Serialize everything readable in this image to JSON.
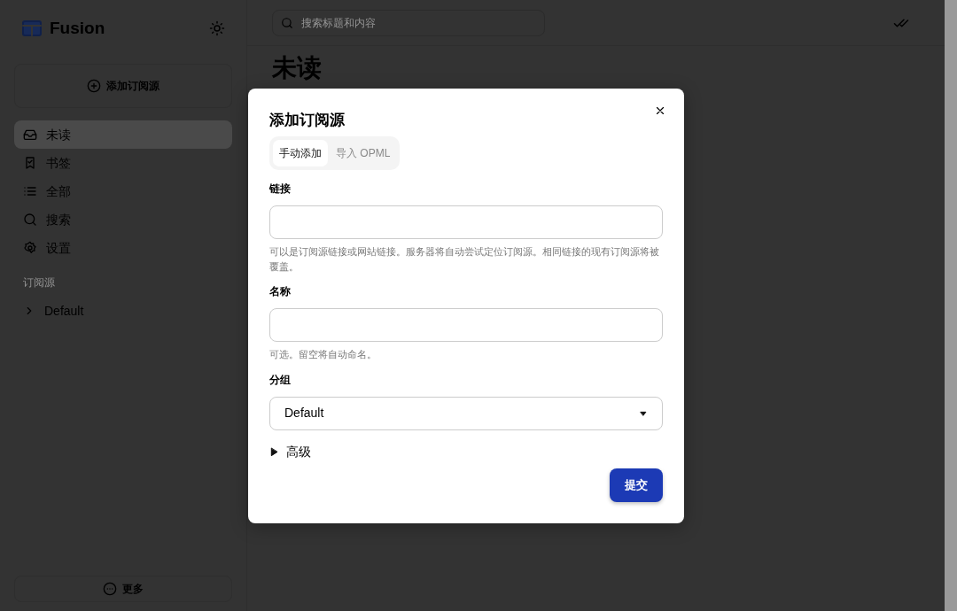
{
  "sidebar": {
    "brand": "Fusion",
    "add_button": "添加订阅源",
    "nav": [
      {
        "label": "未读",
        "selected": true
      },
      {
        "label": "书签",
        "selected": false
      },
      {
        "label": "全部",
        "selected": false
      },
      {
        "label": "搜索",
        "selected": false
      },
      {
        "label": "设置",
        "selected": false
      }
    ],
    "section_title": "订阅源",
    "groups": [
      {
        "label": "Default",
        "expanded": false
      }
    ],
    "more_button": "更多"
  },
  "search": {
    "placeholder": "搜索标题和内容"
  },
  "page_title": "未读",
  "dialog": {
    "title": "添加订阅源",
    "tabs": [
      {
        "label": "手动添加",
        "selected": true
      },
      {
        "label": "导入 OPML",
        "selected": false
      }
    ],
    "fields": [
      {
        "kind": "input",
        "label": "链接",
        "help": "可以是订阅源链接或网站链接。服务器将自动尝试定位订阅源。相同链接的现有订阅源将被覆盖。"
      },
      {
        "kind": "input",
        "label": "名称",
        "help": "可选。留空将自动命名。"
      },
      {
        "kind": "select",
        "label": "分组",
        "value": "Default"
      }
    ],
    "advanced": {
      "label": "高级",
      "expanded": false
    },
    "submit": "提交"
  }
}
